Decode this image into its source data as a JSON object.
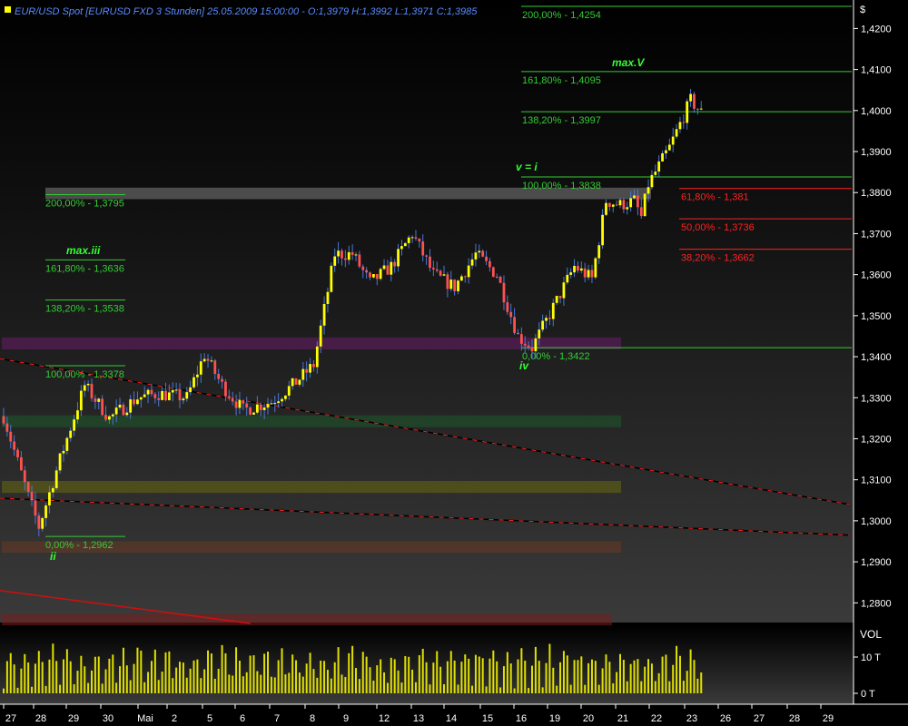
{
  "header": {
    "text": "EUR/USD Spot [EURUSD FXD  3 Stunden] 25.05.2009 15:00:00 - O:1,3979 H:1,3992 L:1,3971 C:1,3985"
  },
  "price_axis": {
    "currency_symbol": "$",
    "labels": [
      "1,4200",
      "1,4100",
      "1,4000",
      "1,3900",
      "1,3800",
      "1,3700",
      "1,3600",
      "1,3500",
      "1,3400",
      "1,3300",
      "1,3200",
      "1,3100",
      "1,3000",
      "1,2900",
      "1,2800"
    ]
  },
  "volume_axis": {
    "title": "VOL",
    "labels": [
      "10 T",
      "0 T"
    ]
  },
  "date_axis": {
    "labels": [
      "27",
      "28",
      "29",
      "30",
      "Mai",
      "2",
      "5",
      "6",
      "7",
      "8",
      "9",
      "12",
      "13",
      "14",
      "15",
      "16",
      "19",
      "20",
      "21",
      "22",
      "23",
      "26",
      "27",
      "28",
      "29"
    ]
  },
  "colors": {
    "background_top": "#000000",
    "background_bottom": "#3a3a3a",
    "up_candle": "#ffff00",
    "down_candle": "#ff5050",
    "wick": "#4a78d8",
    "fib_green": "#33cc33",
    "fib_red": "#ff2020",
    "wave_label": "#33ff33",
    "header_text": "#5a8cff",
    "axis_text": "#ffffff",
    "volume": "#e0e000"
  },
  "wave_labels": [
    "max.V",
    "v = i",
    "max.iii",
    "iv",
    "ii"
  ],
  "fib_levels": {
    "right_green": [
      {
        "label": "200,00% - 1,4254",
        "price": 1.4254
      },
      {
        "label": "161,80% - 1,4095",
        "price": 1.4095
      },
      {
        "label": "138,20% - 1,3997",
        "price": 1.3997
      },
      {
        "label": "100,00% - 1,3838",
        "price": 1.3838
      },
      {
        "label": "0,00% - 1,3422",
        "price": 1.3422
      }
    ],
    "left_green": [
      {
        "label": "200,00% - 1,3795",
        "price": 1.3795
      },
      {
        "label": "161,80% - 1,3636",
        "price": 1.3636
      },
      {
        "label": "138,20% - 1,3538",
        "price": 1.3538
      },
      {
        "label": "100,00% - 1,3378",
        "price": 1.3378
      },
      {
        "label": "0,00% - 1,2962",
        "price": 1.2962
      }
    ],
    "red": [
      {
        "label": "61,80% - 1,381",
        "price": 1.381
      },
      {
        "label": "50,00% - 1,3736",
        "price": 1.3736
      },
      {
        "label": "38,20% - 1,3662",
        "price": 1.3662
      }
    ]
  },
  "zones": [
    {
      "from": 1.3812,
      "to": 1.3784,
      "color": "#808080"
    },
    {
      "from": 1.3447,
      "to": 1.3418,
      "color": "#6a1d6a"
    },
    {
      "from": 1.3257,
      "to": 1.3228,
      "color": "#1d5a2a"
    },
    {
      "from": 1.3097,
      "to": 1.3068,
      "color": "#6a6a10"
    },
    {
      "from": 1.295,
      "to": 1.2922,
      "color": "#6a3a22"
    },
    {
      "from": 1.2773,
      "to": 1.2745,
      "color": "#7a1d1d"
    }
  ],
  "chart_data": {
    "type": "candlestick",
    "title": "EUR/USD Spot [EURUSD FXD  3 Stunden]",
    "ylabel": "$",
    "ylim": [
      1.2752,
      1.4265
    ],
    "grid": false,
    "key_points": [
      [
        0,
        1.3255
      ],
      [
        7,
        1.306
      ],
      [
        10,
        1.2985
      ],
      [
        16,
        1.315
      ],
      [
        23,
        1.333
      ],
      [
        30,
        1.325
      ],
      [
        38,
        1.33
      ],
      [
        44,
        1.331
      ],
      [
        52,
        1.33
      ],
      [
        57,
        1.3405
      ],
      [
        62,
        1.333
      ],
      [
        68,
        1.327
      ],
      [
        76,
        1.329
      ],
      [
        82,
        1.333
      ],
      [
        88,
        1.338
      ],
      [
        94,
        1.365
      ],
      [
        99,
        1.365
      ],
      [
        104,
        1.358
      ],
      [
        110,
        1.362
      ],
      [
        116,
        1.37
      ],
      [
        122,
        1.36
      ],
      [
        128,
        1.357
      ],
      [
        134,
        1.365
      ],
      [
        140,
        1.36
      ],
      [
        146,
        1.345
      ],
      [
        150,
        1.3422
      ],
      [
        156,
        1.352
      ],
      [
        162,
        1.362
      ],
      [
        167,
        1.359
      ],
      [
        171,
        1.378
      ],
      [
        175,
        1.377
      ],
      [
        179,
        1.378
      ],
      [
        181,
        1.374
      ],
      [
        183,
        1.382
      ],
      [
        189,
        1.391
      ],
      [
        195,
        1.4025
      ],
      [
        198,
        1.3995
      ]
    ],
    "volume_range": [
      0,
      12
    ],
    "trendlines": [
      {
        "p1": [
          0,
          1.3395
        ],
        "p2": [
          240,
          1.304
        ],
        "color": "#000000",
        "dash_color": "#ff2020"
      },
      {
        "p1": [
          0,
          1.3055
        ],
        "p2": [
          240,
          1.2965
        ],
        "color": "#000000",
        "dash_color": "#ff2020"
      },
      {
        "p1": [
          0,
          1.283
        ],
        "p2": [
          70,
          1.275
        ],
        "color": "#cc1010"
      }
    ]
  }
}
